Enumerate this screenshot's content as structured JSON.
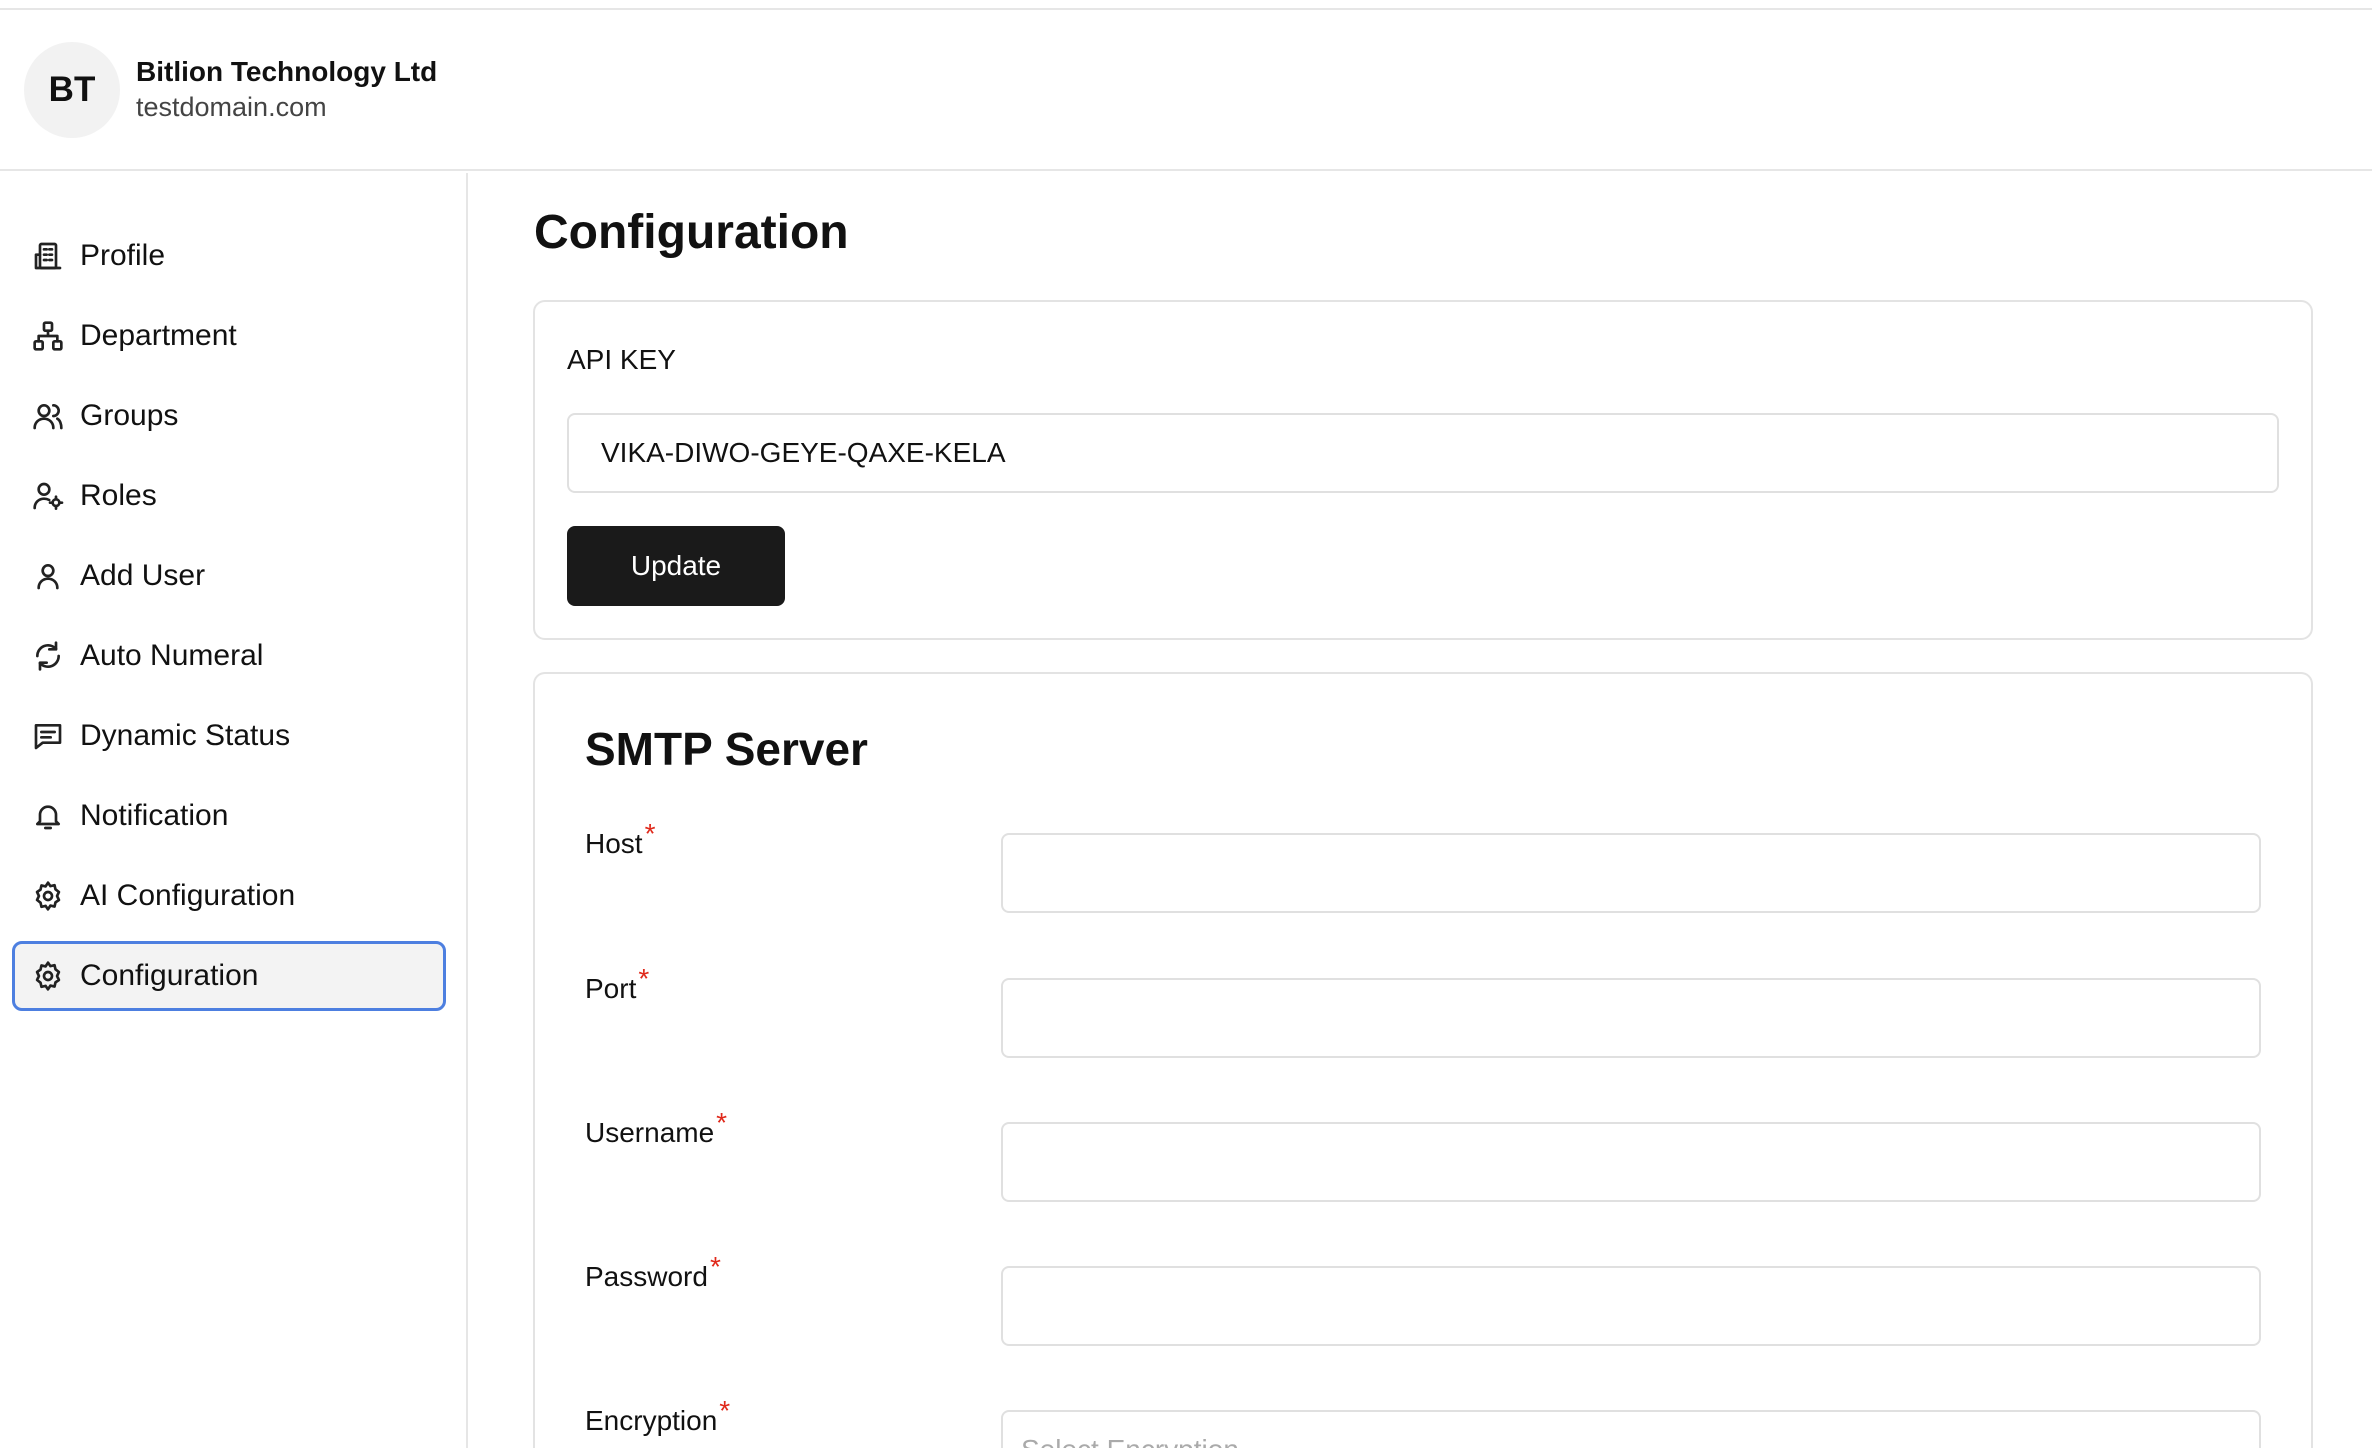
{
  "organization": {
    "initials": "BT",
    "name": "Bitlion Technology Ltd",
    "domain": "testdomain.com"
  },
  "sidebar": {
    "items": [
      {
        "label": "Profile",
        "icon": "building-icon"
      },
      {
        "label": "Department",
        "icon": "hierarchy-icon"
      },
      {
        "label": "Groups",
        "icon": "users-icon"
      },
      {
        "label": "Roles",
        "icon": "user-gear-icon"
      },
      {
        "label": "Add User",
        "icon": "user-icon"
      },
      {
        "label": "Auto Numeral",
        "icon": "refresh-icon"
      },
      {
        "label": "Dynamic Status",
        "icon": "message-icon"
      },
      {
        "label": "Notification",
        "icon": "bell-icon"
      },
      {
        "label": "AI Configuration",
        "icon": "gear-icon"
      },
      {
        "label": "Configuration",
        "icon": "gear-icon",
        "active": true
      }
    ]
  },
  "main": {
    "title": "Configuration",
    "api": {
      "label": "API KEY",
      "value": "VIKA-DIWO-GEYE-QAXE-KELA",
      "update_label": "Update"
    },
    "smtp": {
      "title": "SMTP Server",
      "required_mark": "*",
      "fields": [
        {
          "label": "Host",
          "value": "",
          "placeholder": ""
        },
        {
          "label": "Port",
          "value": "",
          "placeholder": ""
        },
        {
          "label": "Username",
          "value": "",
          "placeholder": ""
        },
        {
          "label": "Password",
          "value": "",
          "placeholder": ""
        },
        {
          "label": "Encryption",
          "value": "",
          "placeholder": "Select Encryption"
        }
      ]
    }
  },
  "colors": {
    "active_border": "#4d7fe0",
    "button_bg": "#1a1a1a",
    "required": "#e0291b"
  }
}
